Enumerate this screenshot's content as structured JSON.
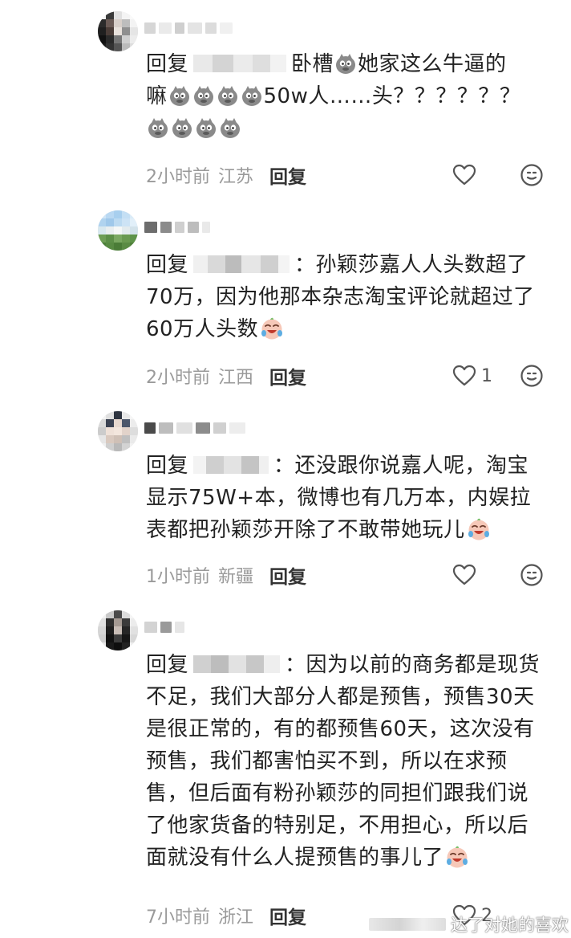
{
  "colors": {
    "text": "#222222",
    "meta": "#9a9a9a",
    "icon": "#555555"
  },
  "comments": [
    {
      "reply_prefix": "回复",
      "text_lines": [
        "卧槽",
        "她家这么牛逼的",
        "嘛",
        "50w人……头？？？？？？"
      ],
      "time": "2小时前",
      "location": "江苏",
      "reply_label": "回复",
      "likes": ""
    },
    {
      "username": "",
      "reply_prefix": "回复",
      "text": "：孙颖莎嘉人人头数超了70万，因为他那本杂志淘宝评论就超过了60万人头数",
      "time": "2小时前",
      "location": "江西",
      "reply_label": "回复",
      "likes": "1"
    },
    {
      "reply_prefix": "回复",
      "text": "：还没跟你说嘉人呢，淘宝显示75W+本，微博也有几万本，内娱拉表都把孙颖莎开除了不敢带她玩儿",
      "time": "1小时前",
      "location": "新疆",
      "reply_label": "回复",
      "likes": ""
    },
    {
      "reply_prefix": "回复",
      "text": "：因为以前的商务都是现货不足，我们大部分人都是预售，预售30天是很正常的，有的都预售60天，这次没有预售，我们都害怕买不到，所以在求预售，但后面有粉孙颖莎的同担们跟我们说了他家货备的特别足，不用担心，所以后面就没有什么人提预售的事儿了",
      "time": "7小时前",
      "location": "浙江",
      "reply_label": "回复",
      "likes": "2"
    }
  ],
  "watermark": "达了对她的喜欢",
  "icons": {
    "like": "heart-outline-icon",
    "react": "smiley-icon",
    "emoji_grey": "doge-grey-emoji",
    "emoji_cry": "laugh-cry-emoji"
  }
}
